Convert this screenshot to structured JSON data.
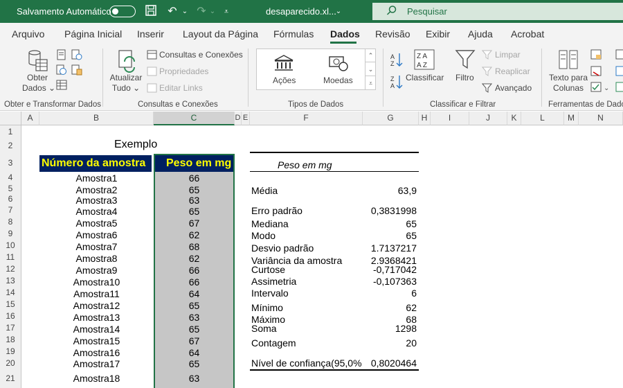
{
  "titlebar": {
    "autosave_label": "Salvamento Automático",
    "filename": "desaparecido.xl...",
    "search_placeholder": "Pesquisar"
  },
  "ribbon_tabs": [
    "Arquivo",
    "Página Inicial",
    "Inserir",
    "Layout da Página",
    "Fórmulas",
    "Dados",
    "Revisão",
    "Exibir",
    "Ajuda",
    "Acrobat"
  ],
  "active_tab": "Dados",
  "ribbon": {
    "obter_dados": [
      "Obter",
      "Dados"
    ],
    "atualizar_tudo": [
      "Atualizar",
      "Tudo"
    ],
    "consultas_conexoes": "Consultas e Conexões",
    "propriedades": "Propriedades",
    "editar_links": "Editar Links",
    "acoes": "Ações",
    "moedas": "Moedas",
    "classificar": "Classificar",
    "filtro": "Filtro",
    "limpar": "Limpar",
    "reaplicar": "Reaplicar",
    "avancado": "Avançado",
    "texto_para_colunas": [
      "Texto para",
      "Colunas"
    ],
    "groups": {
      "g1": "Obter e Transformar Dados",
      "g2": "Consultas e Conexões",
      "g3": "Tipos de Dados",
      "g4": "Classificar e Filtrar",
      "g5": "Ferramentas de Dados"
    }
  },
  "columns": [
    "A",
    "B",
    "C",
    "D",
    "E",
    "F",
    "G",
    "H",
    "I",
    "J",
    "K",
    "L",
    "M",
    "N"
  ],
  "rows": [
    "1",
    "2",
    "3",
    "4",
    "5",
    "6",
    "7",
    "8",
    "9",
    "10",
    "11",
    "12",
    "13",
    "14",
    "15",
    "16",
    "17",
    "18",
    "19",
    "20",
    "21"
  ],
  "sheet": {
    "exemplo": "Exemplo",
    "header_amostra": "Número da amostra",
    "header_peso": "Peso em mg",
    "samples": [
      {
        "name": "Amostra1",
        "value": "66"
      },
      {
        "name": "Amostra2",
        "value": "65"
      },
      {
        "name": "Amostra3",
        "value": "63"
      },
      {
        "name": "Amostra4",
        "value": "65"
      },
      {
        "name": "Amostra5",
        "value": "67"
      },
      {
        "name": "Amostra6",
        "value": "62"
      },
      {
        "name": "Amostra7",
        "value": "68"
      },
      {
        "name": "Amostra8",
        "value": "62"
      },
      {
        "name": "Amostra9",
        "value": "66"
      },
      {
        "name": "Amostra10",
        "value": "66"
      },
      {
        "name": "Amostra11",
        "value": "64"
      },
      {
        "name": "Amostra12",
        "value": "65"
      },
      {
        "name": "Amostra13",
        "value": "63"
      },
      {
        "name": "Amostra14",
        "value": "65"
      },
      {
        "name": "Amostra15",
        "value": "67"
      },
      {
        "name": "Amostra16",
        "value": "64"
      },
      {
        "name": "Amostra17",
        "value": "65"
      },
      {
        "name": "Amostra18",
        "value": "63"
      }
    ],
    "stats_title": "Peso em mg",
    "stats": [
      {
        "label": "Média",
        "value": "63,9"
      },
      {
        "label": "Erro padrão",
        "value": "0,3831998"
      },
      {
        "label": "Mediana",
        "value": "65"
      },
      {
        "label": "Modo",
        "value": "65"
      },
      {
        "label": "Desvio padrão",
        "value": "1.7137217"
      },
      {
        "label": "Variância da amostra",
        "value": "2.9368421"
      },
      {
        "label": "Curtose",
        "value": "-0,717042"
      },
      {
        "label": "Assimetria",
        "value": "-0,107363"
      },
      {
        "label": "Intervalo",
        "value": "6"
      },
      {
        "label": "Mínimo",
        "value": "62"
      },
      {
        "label": "Máximo",
        "value": "68"
      },
      {
        "label": "Soma",
        "value": "1298"
      },
      {
        "label": "Contagem",
        "value": "20"
      },
      {
        "label": "Nível de confiança(95,0%",
        "value": "0,8020464"
      }
    ]
  }
}
